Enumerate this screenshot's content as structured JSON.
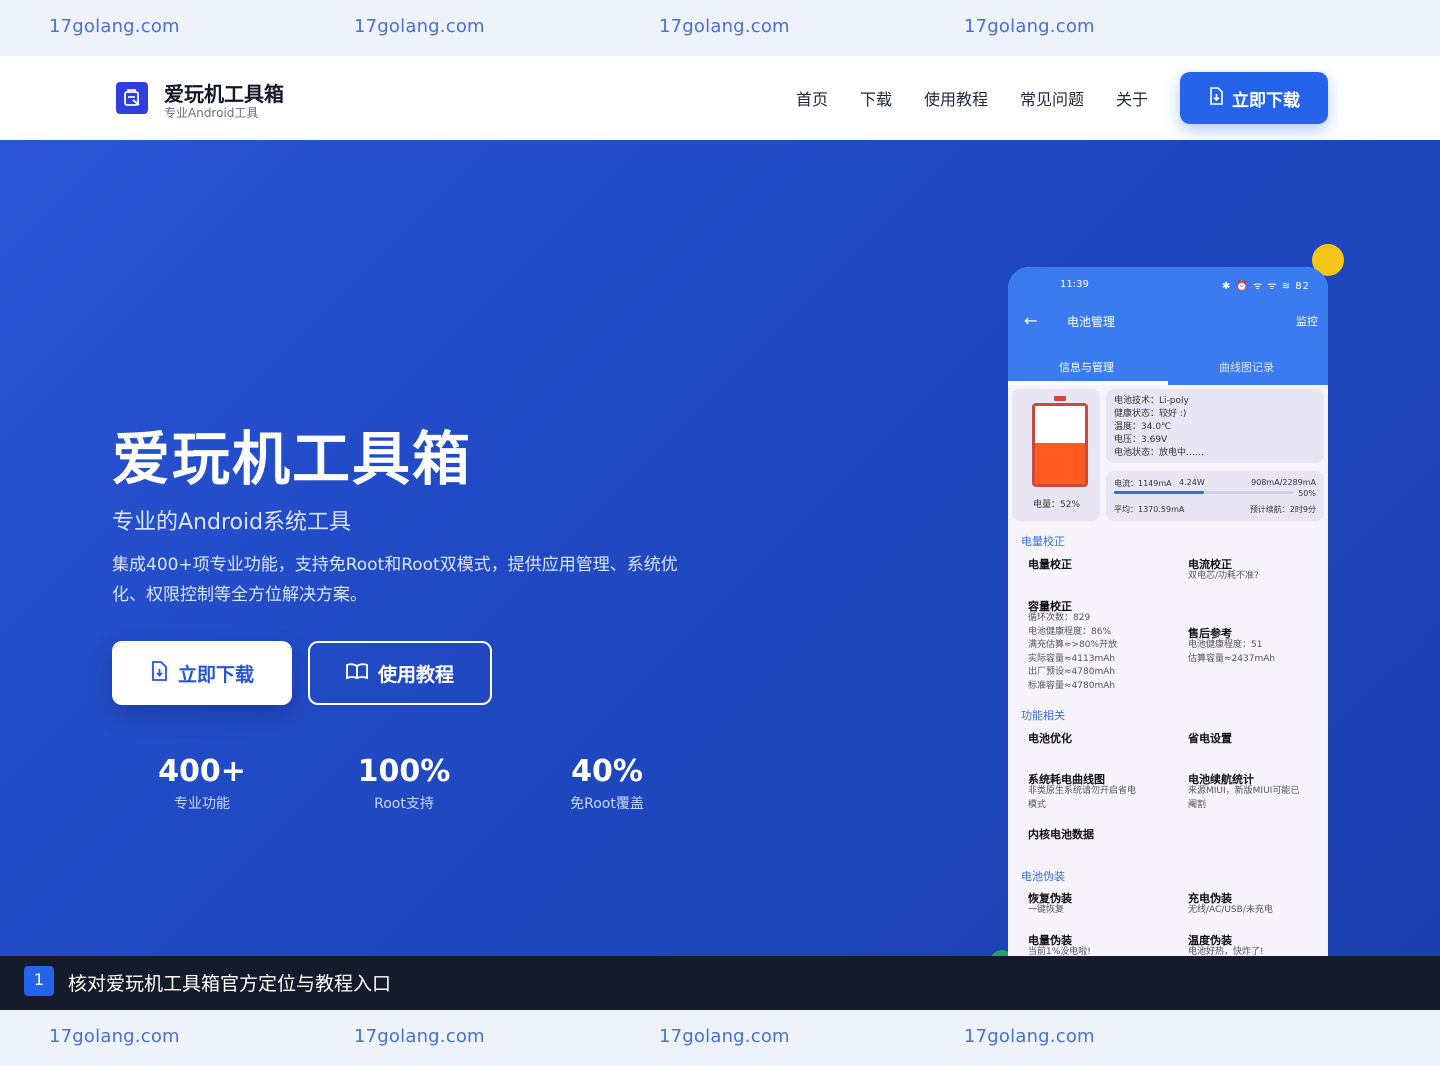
{
  "watermark": {
    "text": "17golang.com"
  },
  "nav": {
    "brand_title": "爱玩机工具箱",
    "brand_sub": "专业Android工具",
    "links": [
      "首页",
      "下载",
      "使用教程",
      "常见问题",
      "关于"
    ],
    "cta": "立即下载"
  },
  "hero": {
    "title": "爱玩机工具箱",
    "subtitle": "专业的Android系统工具",
    "description": "集成400+项专业功能，支持免Root和Root双模式，提供应用管理、系统优化、权限控制等全方位解决方案。",
    "primary_button": "立即下载",
    "secondary_button": "使用教程",
    "stats": [
      {
        "value": "400+",
        "label": "专业功能"
      },
      {
        "value": "100%",
        "label": "Root支持"
      },
      {
        "value": "40%",
        "label": "免Root覆盖"
      }
    ]
  },
  "phone": {
    "time": "11:39",
    "status_icons": "✱ ⏰ ᯤ ᯤ ≋ 82",
    "title": "电池管理",
    "monitor": "监控",
    "tabs": [
      "信息与管理",
      "曲线图记录"
    ],
    "battery_level": 0.52,
    "battery_label": "电量：52%",
    "info_lines": [
      "电池技术：Li-poly",
      "健康状态：较好 :)",
      "温度：34.0℃",
      "电压：3.69V",
      "电池状态：放电中……"
    ],
    "current": "电流：1149mA",
    "power": "4.24W",
    "capacity_now": "908mA/2289mA",
    "capacity_pct": "50%",
    "progress": 0.5,
    "average": "平均：1370.59mA",
    "eta": "预计续航：2时9分",
    "sections": [
      {
        "heading": "电量校正",
        "items": [
          {
            "title": "电量校正",
            "sub": []
          },
          {
            "title": "电流校正",
            "sub": [
              "双电芯/功耗不准?"
            ]
          },
          {
            "title": "容量校正",
            "sub": [
              "循环次数：829",
              "电池健康程度：86%",
              "满充估算≈>80%开放",
              "实际容量≈4113mAh",
              "出厂预设≈4780mAh",
              "标准容量≈4780mAh"
            ]
          },
          {
            "title": "售后参考",
            "sub": [
              "电池健康程度：51",
              "估算容量≈2437mAh"
            ]
          }
        ]
      },
      {
        "heading": "功能相关",
        "items": [
          {
            "title": "电池优化",
            "sub": []
          },
          {
            "title": "省电设置",
            "sub": []
          },
          {
            "title": "系统耗电曲线图",
            "sub": [
              "非类原生系统请勿开启省电",
              "模式"
            ]
          },
          {
            "title": "电池续航统计",
            "sub": [
              "来源MIUI，新版MIUI可能已",
              "阉割"
            ]
          },
          {
            "title": "内核电池数据",
            "sub": []
          }
        ]
      },
      {
        "heading": "电池伪装",
        "items": [
          {
            "title": "恢复伪装",
            "sub": [
              "一键恢复"
            ]
          },
          {
            "title": "充电伪装",
            "sub": [
              "无线/AC/USB/未充电"
            ]
          },
          {
            "title": "电量伪装",
            "sub": [
              "当前1%没电啦!"
            ]
          },
          {
            "title": "温度伪装",
            "sub": [
              "电池好热，快炸了!"
            ]
          }
        ]
      }
    ]
  },
  "banner": {
    "number": "1",
    "text": "核对爱玩机工具箱官方定位与教程入口"
  },
  "colors": {
    "primary": "#2563eb",
    "hero_bg": "#1f48c2",
    "accent_orange": "#ff5a1f",
    "banner_bg": "#151b2b"
  }
}
